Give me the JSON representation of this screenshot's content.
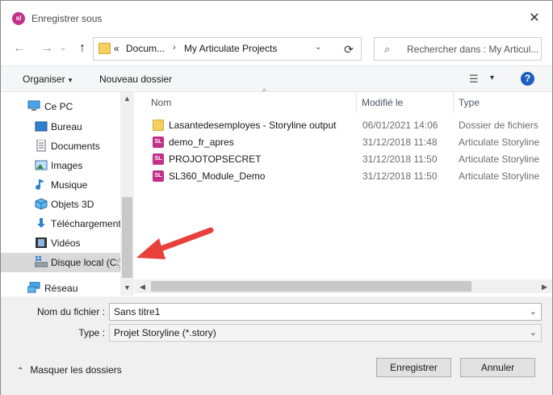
{
  "window": {
    "title": "Enregistrer sous",
    "app_icon_text": "sl",
    "close_glyph": "✕"
  },
  "address": {
    "back_glyph": "←",
    "forward_glyph": "→",
    "up_glyph": "↑",
    "overflow": "«",
    "crumbs": [
      "Docum...",
      "My Articulate Projects"
    ],
    "sep_glyph": "›",
    "chevron_glyph": "⌄",
    "refresh_glyph": "⟳"
  },
  "search": {
    "icon_glyph": "⌕",
    "placeholder": "Rechercher dans : My Articul..."
  },
  "toolbar": {
    "organize_label": "Organiser",
    "new_folder_label": "Nouveau dossier",
    "view_glyph": "☰",
    "dd_glyph": "▾",
    "help_glyph": "?"
  },
  "nav": {
    "items": [
      {
        "label": "Ce PC",
        "icon": "computer-icon",
        "selected": false
      },
      {
        "label": "Bureau",
        "icon": "desktop-icon",
        "selected": false
      },
      {
        "label": "Documents",
        "icon": "documents-icon",
        "selected": false
      },
      {
        "label": "Images",
        "icon": "images-icon",
        "selected": false
      },
      {
        "label": "Musique",
        "icon": "music-icon",
        "selected": false
      },
      {
        "label": "Objets 3D",
        "icon": "objects3d-icon",
        "selected": false
      },
      {
        "label": "Téléchargements",
        "icon": "downloads-icon",
        "selected": false
      },
      {
        "label": "Vidéos",
        "icon": "videos-icon",
        "selected": false
      },
      {
        "label": "Disque local (C:)",
        "icon": "drive-icon",
        "selected": true
      },
      {
        "label": "Réseau",
        "icon": "network-icon",
        "selected": false
      }
    ],
    "scroll_up_glyph": "▲",
    "scroll_down_glyph": "▼"
  },
  "files": {
    "headers": {
      "name": "Nom",
      "modified": "Modifié le",
      "type": "Type"
    },
    "sort_glyph": "^",
    "rows": [
      {
        "name": "Lasantedesemployes - Storyline output",
        "modified": "06/01/2021 14:06",
        "type": "Dossier de fichiers",
        "kind": "folder"
      },
      {
        "name": "demo_fr_apres",
        "modified": "31/12/2018 11:48",
        "type": "Articulate Storyline",
        "kind": "storyline"
      },
      {
        "name": "PROJOTOPSECRET",
        "modified": "31/12/2018 11:50",
        "type": "Articulate Storyline",
        "kind": "storyline"
      },
      {
        "name": "SL360_Module_Demo",
        "modified": "31/12/2018 11:50",
        "type": "Articulate Storyline",
        "kind": "storyline"
      }
    ],
    "file_icon_text": "SL",
    "scroll_left_glyph": "◀",
    "scroll_right_glyph": "▶"
  },
  "form": {
    "filename_label": "Nom du fichier :",
    "filename_value": "Sans titre1",
    "type_label": "Type :",
    "type_value": "Projet Storyline (*.story)",
    "dd_glyph": "⌄",
    "hide_folders_label": "Masquer les dossiers",
    "hide_glyph": "⌃",
    "save_label": "Enregistrer",
    "cancel_label": "Annuler"
  },
  "colors": {
    "accent_storyline": "#c2308a",
    "folder_yellow": "#f4cf62",
    "annotation_red": "#e8413b",
    "help_blue": "#1f5fbf"
  }
}
